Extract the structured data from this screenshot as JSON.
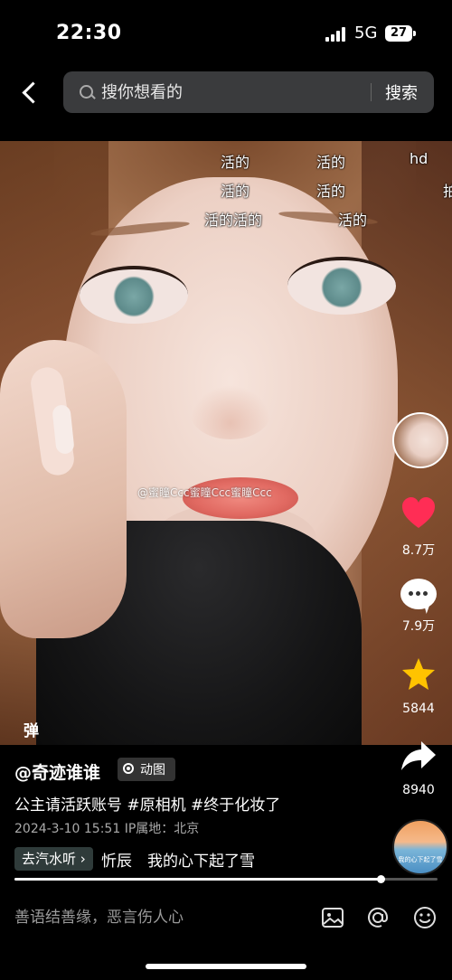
{
  "status_bar": {
    "time": "22:30",
    "network": "5G",
    "battery": "27"
  },
  "search": {
    "placeholder": "搜你想看的",
    "button_label": "搜索"
  },
  "video": {
    "danmaku": [
      {
        "text": "活的"
      },
      {
        "text": "活的"
      },
      {
        "text": "hd"
      },
      {
        "text": "活的"
      },
      {
        "text": "活的"
      },
      {
        "text": "拍"
      },
      {
        "text": "活的活的"
      },
      {
        "text": "活的"
      }
    ],
    "watermark": "@蜜瞳Ccc蜜瞳Ccc蜜瞳Ccc",
    "danmu_toggle": "弹"
  },
  "actions": {
    "likes": "8.7万",
    "comments": "7.9万",
    "favorites": "5844",
    "shares": "8940"
  },
  "post": {
    "author": "@奇迹谁谁",
    "badge": "动图",
    "description": "公主请活跃账号 #原相机 #终于化妆了",
    "timestamp": "2024-3-10 15:51",
    "ip_location": "IP属地：北京",
    "music_tag": "去汽水听 ›",
    "music_text": "忻辰　我的心下起了雪",
    "music_disc_text": "我的心下起了雪"
  },
  "progress": {
    "fraction": 0.865
  },
  "comment_bar": {
    "placeholder": "善语结善缘，恶言伤人心"
  },
  "colors": {
    "like": "#ff2d55",
    "favorite": "#ffc300",
    "background": "#000000"
  }
}
